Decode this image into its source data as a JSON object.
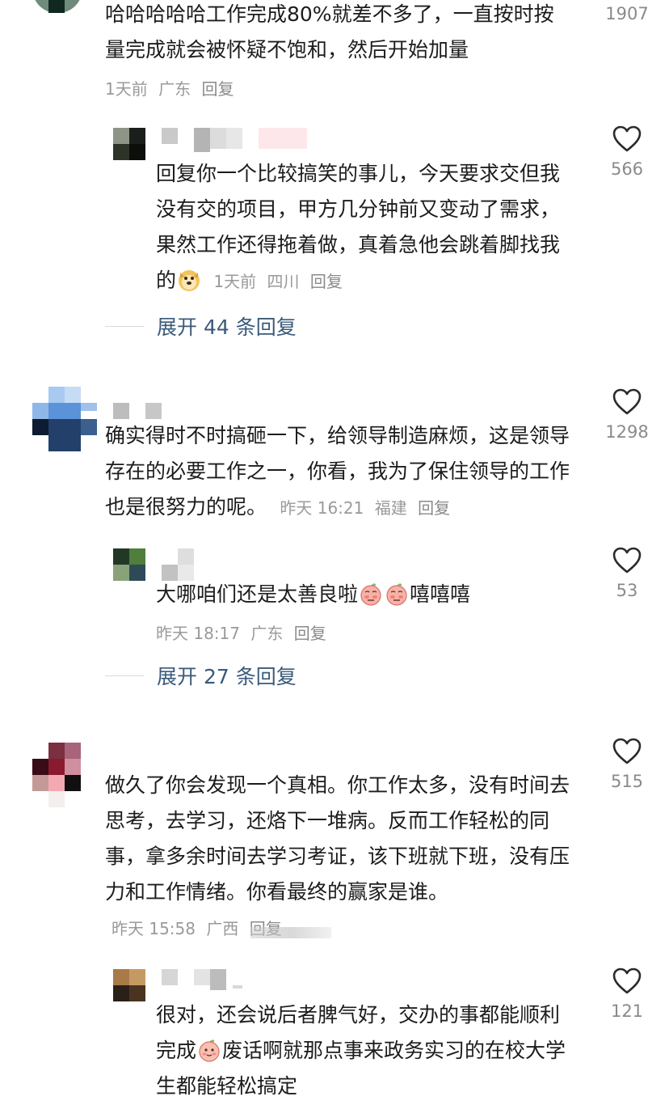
{
  "comments": [
    {
      "text": "哈哈哈哈哈工作完成80%就差不多了，一直按时按量完成就会被怀疑不饱和，然后开始加量",
      "time": "1天前",
      "location": "广东",
      "reply_label": "回复",
      "likes": "1907",
      "replies": [
        {
          "text_before_emoji": "回复你一个比较搞笑的事儿，今天要求交但我没有交的项目，甲方几分钟前又变动了需求，果然工作还得拖着做，真着急他会跳着脚找我的",
          "emoji": "doge-icon",
          "time": "1天前",
          "location": "四川",
          "reply_label": "回复",
          "likes": "566"
        }
      ],
      "expand_label": "展开 44 条回复"
    },
    {
      "text": "确实得时不时搞砸一下，给领导制造麻烦，这是领导存在的必要工作之一，你看，我为了保住领导的工作也是很努力的呢。",
      "time": "昨天 16:21",
      "location": "福建",
      "reply_label": "回复",
      "likes": "1298",
      "replies": [
        {
          "text_before_emoji": "大哪咱们还是太善良啦",
          "emoji": "shy-peach-icon",
          "text_after_emoji": "嘻嘻嘻",
          "time": "昨天 18:17",
          "location": "广东",
          "reply_label": "回复",
          "likes": "53"
        }
      ],
      "expand_label": "展开 27 条回复"
    },
    {
      "text": "做久了你会发现一个真相。你工作太多，没有时间去思考，去学习，还烙下一堆病。反而工作轻松的同事，拿多余时间去学习考证，该下班就下班，没有压力和工作情绪。你看最终的赢家是谁。",
      "time": "昨天 15:58",
      "location": "广西",
      "reply_label": "回复",
      "likes": "515",
      "replies": [
        {
          "text_before_emoji": "很对，还会说后者脾气好，交办的事都能顺利完成",
          "emoji": "peach-icon",
          "text_after_emoji": "废话啊就那点事来政务实习的在校大学生都能轻松搞定",
          "likes": "121"
        }
      ]
    }
  ],
  "colors": {
    "meta": "#9a9a9a",
    "expand": "#3a5a7a",
    "heart_outline": "#2b2b2b"
  }
}
